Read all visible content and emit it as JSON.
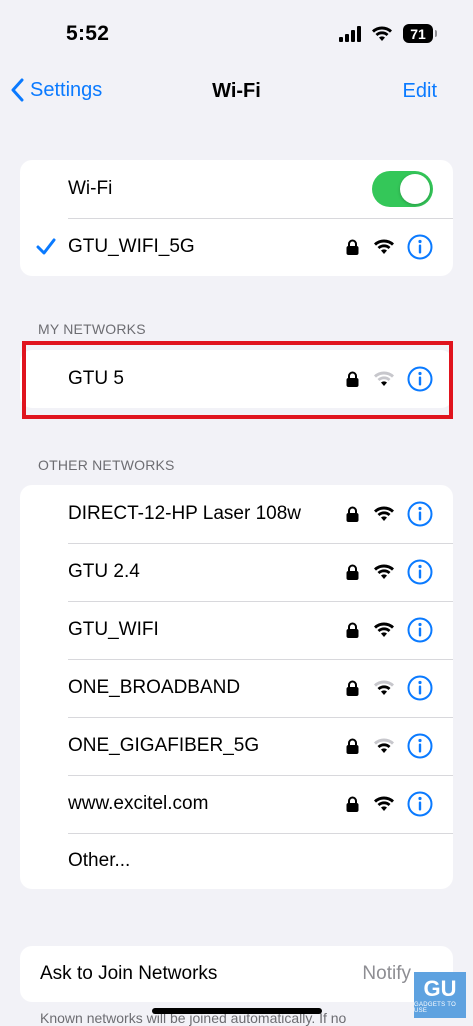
{
  "status_bar": {
    "time": "5:52",
    "battery": "71"
  },
  "nav": {
    "back_label": "Settings",
    "title": "Wi-Fi",
    "edit_label": "Edit"
  },
  "wifi_toggle": {
    "label": "Wi-Fi",
    "on": true
  },
  "connected": {
    "name": "GTU_WIFI_5G"
  },
  "my_networks": {
    "header": "MY NETWORKS",
    "items": [
      {
        "name": "GTU 5",
        "strength": "weak"
      }
    ]
  },
  "other_networks": {
    "header": "OTHER NETWORKS",
    "items": [
      {
        "name": "DIRECT-12-HP Laser 108w",
        "strength": "full"
      },
      {
        "name": "GTU 2.4",
        "strength": "full"
      },
      {
        "name": "GTU_WIFI",
        "strength": "full"
      },
      {
        "name": "ONE_BROADBAND",
        "strength": "medium"
      },
      {
        "name": "ONE_GIGAFIBER_5G",
        "strength": "medium"
      },
      {
        "name": "www.excitel.com",
        "strength": "full"
      }
    ],
    "other_label": "Other..."
  },
  "ask_to_join": {
    "label": "Ask to Join Networks",
    "value": "Notify"
  },
  "footer": "Known networks will be joined automatically. If no",
  "watermark": {
    "logo": "GU",
    "text": "GADGETS TO USE"
  },
  "colors": {
    "accent": "#0a7aff",
    "toggle_on": "#34c759",
    "highlight": "#e0141e"
  }
}
